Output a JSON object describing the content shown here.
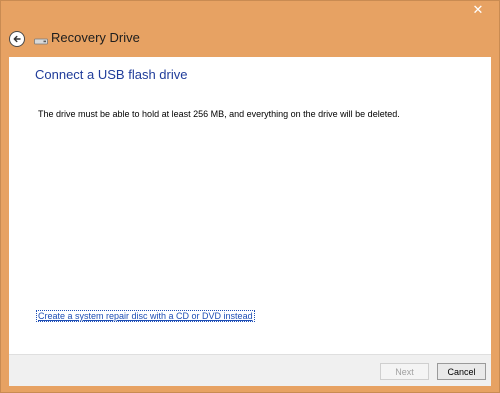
{
  "window": {
    "title": "Recovery Drive",
    "close_glyph": "✕"
  },
  "icons": {
    "back": "back-arrow-icon",
    "drive": "drive-icon",
    "close": "close-icon"
  },
  "content": {
    "heading": "Connect a USB flash drive",
    "body": "The drive must be able to hold at least 256 MB, and everything on the drive will be deleted.",
    "repair_link": "Create a system repair disc with a CD or DVD instead"
  },
  "footer": {
    "next_label": "Next",
    "cancel_label": "Cancel"
  },
  "colors": {
    "frame": "#e7a263",
    "heading": "#1f3c9a",
    "link": "#1f4fb6"
  }
}
